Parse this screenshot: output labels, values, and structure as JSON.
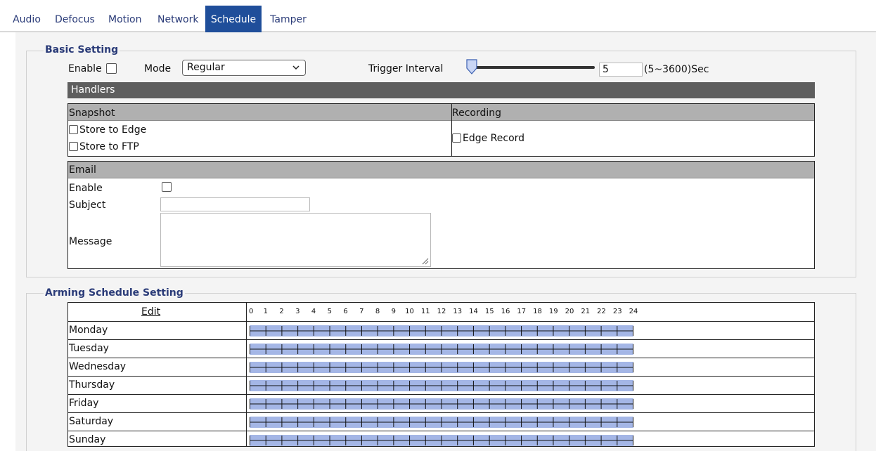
{
  "tabs": [
    {
      "label": "Audio",
      "active": false
    },
    {
      "label": "Defocus",
      "active": false
    },
    {
      "label": "Motion",
      "active": false
    },
    {
      "label": "Network",
      "active": false
    },
    {
      "label": "Schedule",
      "active": true
    },
    {
      "label": "Tamper",
      "active": false
    }
  ],
  "basic": {
    "legend": "Basic Setting",
    "enable_label": "Enable",
    "enable_checked": false,
    "mode_label": "Mode",
    "mode_value": "Regular",
    "trigger_label": "Trigger Interval",
    "trigger_value": "5",
    "trigger_range": "(5~3600)Sec",
    "handlers_title": "Handlers",
    "snapshot": {
      "title": "Snapshot",
      "store_edge": "Store to Edge",
      "store_ftp": "Store to FTP"
    },
    "recording": {
      "title": "Recording",
      "edge_record": "Edge Record"
    },
    "email": {
      "title": "Email",
      "enable_label": "Enable",
      "subject_label": "Subject",
      "subject_value": "",
      "message_label": "Message",
      "message_value": ""
    }
  },
  "arming": {
    "legend": "Arming Schedule Setting",
    "edit_label": "Edit",
    "hours": [
      "0",
      "1",
      "2",
      "3",
      "4",
      "5",
      "6",
      "7",
      "8",
      "9",
      "10",
      "11",
      "12",
      "13",
      "14",
      "15",
      "16",
      "17",
      "18",
      "19",
      "20",
      "21",
      "22",
      "23",
      "24"
    ],
    "days": [
      "Monday",
      "Tuesday",
      "Wednesday",
      "Thursday",
      "Friday",
      "Saturday",
      "Sunday"
    ]
  },
  "colors": {
    "tab_active": "#1f4e9a",
    "accent_text": "#2a3b78",
    "schedule_fill": "#a4b6e6",
    "handlers_bar": "#5e5e5e",
    "section_head": "#b0b0b0"
  },
  "icons": {
    "select_arrow": "chevron-down-icon",
    "slider": "slider-thumb-icon",
    "resize": "resize-grip-icon"
  }
}
